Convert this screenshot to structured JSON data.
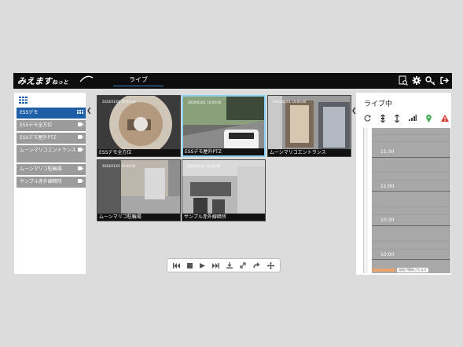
{
  "app": {
    "logo_main": "みえます",
    "logo_small": "ねっと",
    "nav_tab": "ライブ"
  },
  "top_icons": [
    "report-search-icon",
    "gear-icon",
    "key-icon",
    "logout-icon"
  ],
  "sidebar": {
    "items": [
      {
        "label": "ESSデモ",
        "selected": true
      },
      {
        "label": "ESSデモ全方位",
        "selected": false
      },
      {
        "label": "ESSデモ屋外PTZ",
        "selected": false
      },
      {
        "label": "ムーンマリコエントランス",
        "selected": false
      },
      {
        "label": "ムーンマリコ駐輪場",
        "selected": false
      },
      {
        "label": "サンプル赤外線暗所",
        "selected": false
      }
    ]
  },
  "cameras": [
    {
      "caption": "ESSデモ全方位",
      "stamp": "2020/01/01 10:00:00"
    },
    {
      "caption": "ESSデモ屋外PTZ",
      "stamp": "2020/01/01 10:00:00",
      "active": true
    },
    {
      "caption": "ムーンマリコエントランス",
      "stamp": "2020/01/01 10:00:00"
    },
    {
      "caption": "ムーンマリコ駐輪場",
      "stamp": "2020/01/01 10:00:00"
    },
    {
      "caption": "サンプル赤外線暗所",
      "stamp": "2020/01/01 10:00:00"
    }
  ],
  "playback_controls": [
    "skip-back-icon",
    "stop-icon",
    "play-icon",
    "skip-forward-icon",
    "download-icon",
    "fullscreen-icon",
    "share-icon",
    "move-icon"
  ],
  "right_panel": {
    "title": "ライブ中",
    "icons": [
      "refresh-icon",
      "zoom-in-icon",
      "zoom-out-icon",
      "signal-icon",
      "location-icon",
      "warning-icon"
    ],
    "timeline_labels": [
      "11:30",
      "11:00",
      "10:30",
      "10:00"
    ],
    "now_badge": "録画が開始されます"
  },
  "colors": {
    "topbar": "#0d0d0d",
    "accent_blue": "#1f5fa8",
    "sidebar_item": "#9b9b9b",
    "warning": "#d63a32",
    "location": "#38a84a",
    "timeline": "#a8a8a8"
  }
}
